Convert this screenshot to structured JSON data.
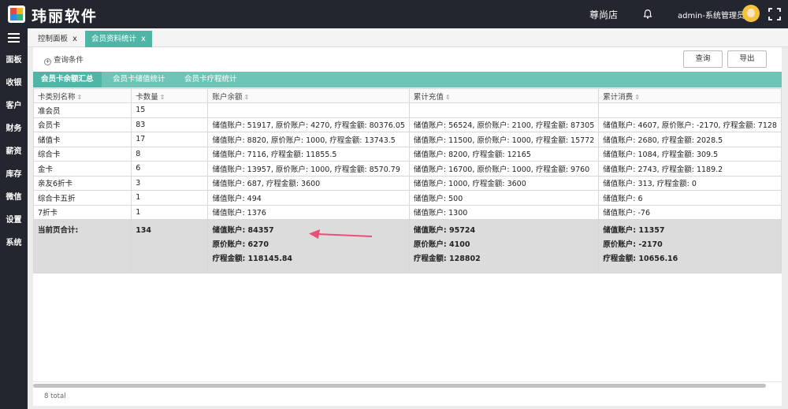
{
  "header": {
    "brand": "玮丽软件",
    "store": "尊尚店",
    "user": "admin-系统管理员"
  },
  "sidebar": {
    "items": [
      "面板",
      "收银",
      "客户",
      "财务",
      "薪资",
      "库存",
      "微信",
      "设置",
      "系统"
    ]
  },
  "page_tabs": [
    {
      "label": "控制面板",
      "close": "x"
    },
    {
      "label": "会员资料统计",
      "close": "x"
    }
  ],
  "toolbar": {
    "query_condition": "查询条件",
    "query_button": "查询",
    "export_button": "导出"
  },
  "sub_tabs": [
    "会员卡余额汇总",
    "会员卡储值统计",
    "会员卡疗程统计"
  ],
  "table": {
    "headers": [
      "卡类别名称",
      "卡数量",
      "账户余额",
      "累计充值",
      "累计消费"
    ],
    "rows": [
      [
        "准会员",
        "15",
        "",
        "",
        ""
      ],
      [
        "会员卡",
        "83",
        "储值账户: 51917, 原价账户: 4270, 疗程金额: 80376.05",
        "储值账户: 56524, 原价账户: 2100, 疗程金额: 87305",
        "储值账户: 4607, 原价账户: -2170, 疗程金额: 7128"
      ],
      [
        "储值卡",
        "17",
        "储值账户: 8820, 原价账户: 1000, 疗程金额: 13743.5",
        "储值账户: 11500, 原价账户: 1000, 疗程金额: 15772",
        "储值账户: 2680, 疗程金额: 2028.5"
      ],
      [
        "综合卡",
        "8",
        "储值账户: 7116, 疗程金额: 11855.5",
        "储值账户: 8200, 疗程金额: 12165",
        "储值账户: 1084, 疗程金额: 309.5"
      ],
      [
        "金卡",
        "6",
        "储值账户: 13957, 原价账户: 1000, 疗程金额: 8570.79",
        "储值账户: 16700, 原价账户: 1000, 疗程金额: 9760",
        "储值账户: 2743, 疗程金额: 1189.2"
      ],
      [
        "亲友6折卡",
        "3",
        "储值账户: 687, 疗程金额: 3600",
        "储值账户: 1000, 疗程金额: 3600",
        "储值账户: 313, 疗程金额: 0"
      ],
      [
        "综合卡五折",
        "1",
        "储值账户: 494",
        "储值账户: 500",
        "储值账户: 6"
      ],
      [
        "7折卡",
        "1",
        "储值账户: 1376",
        "储值账户: 1300",
        "储值账户: -76"
      ]
    ],
    "total": {
      "label": "当前页合计:",
      "count": "134",
      "balance": [
        "储值账户: 84357",
        "原价账户: 6270",
        "疗程金额: 118145.84"
      ],
      "recharge": [
        "储值账户: 95724",
        "原价账户: 4100",
        "疗程金额: 128802"
      ],
      "consume": [
        "储值账户: 11357",
        "原价账户: -2170",
        "疗程金额: 10656.16"
      ]
    }
  },
  "footer": {
    "total_count": "8 total"
  },
  "colors": {
    "topbar": "#23262e",
    "accent": "#4fb6a7",
    "subtab_bg": "#6ec5b7",
    "arrow": "#e8507a"
  }
}
